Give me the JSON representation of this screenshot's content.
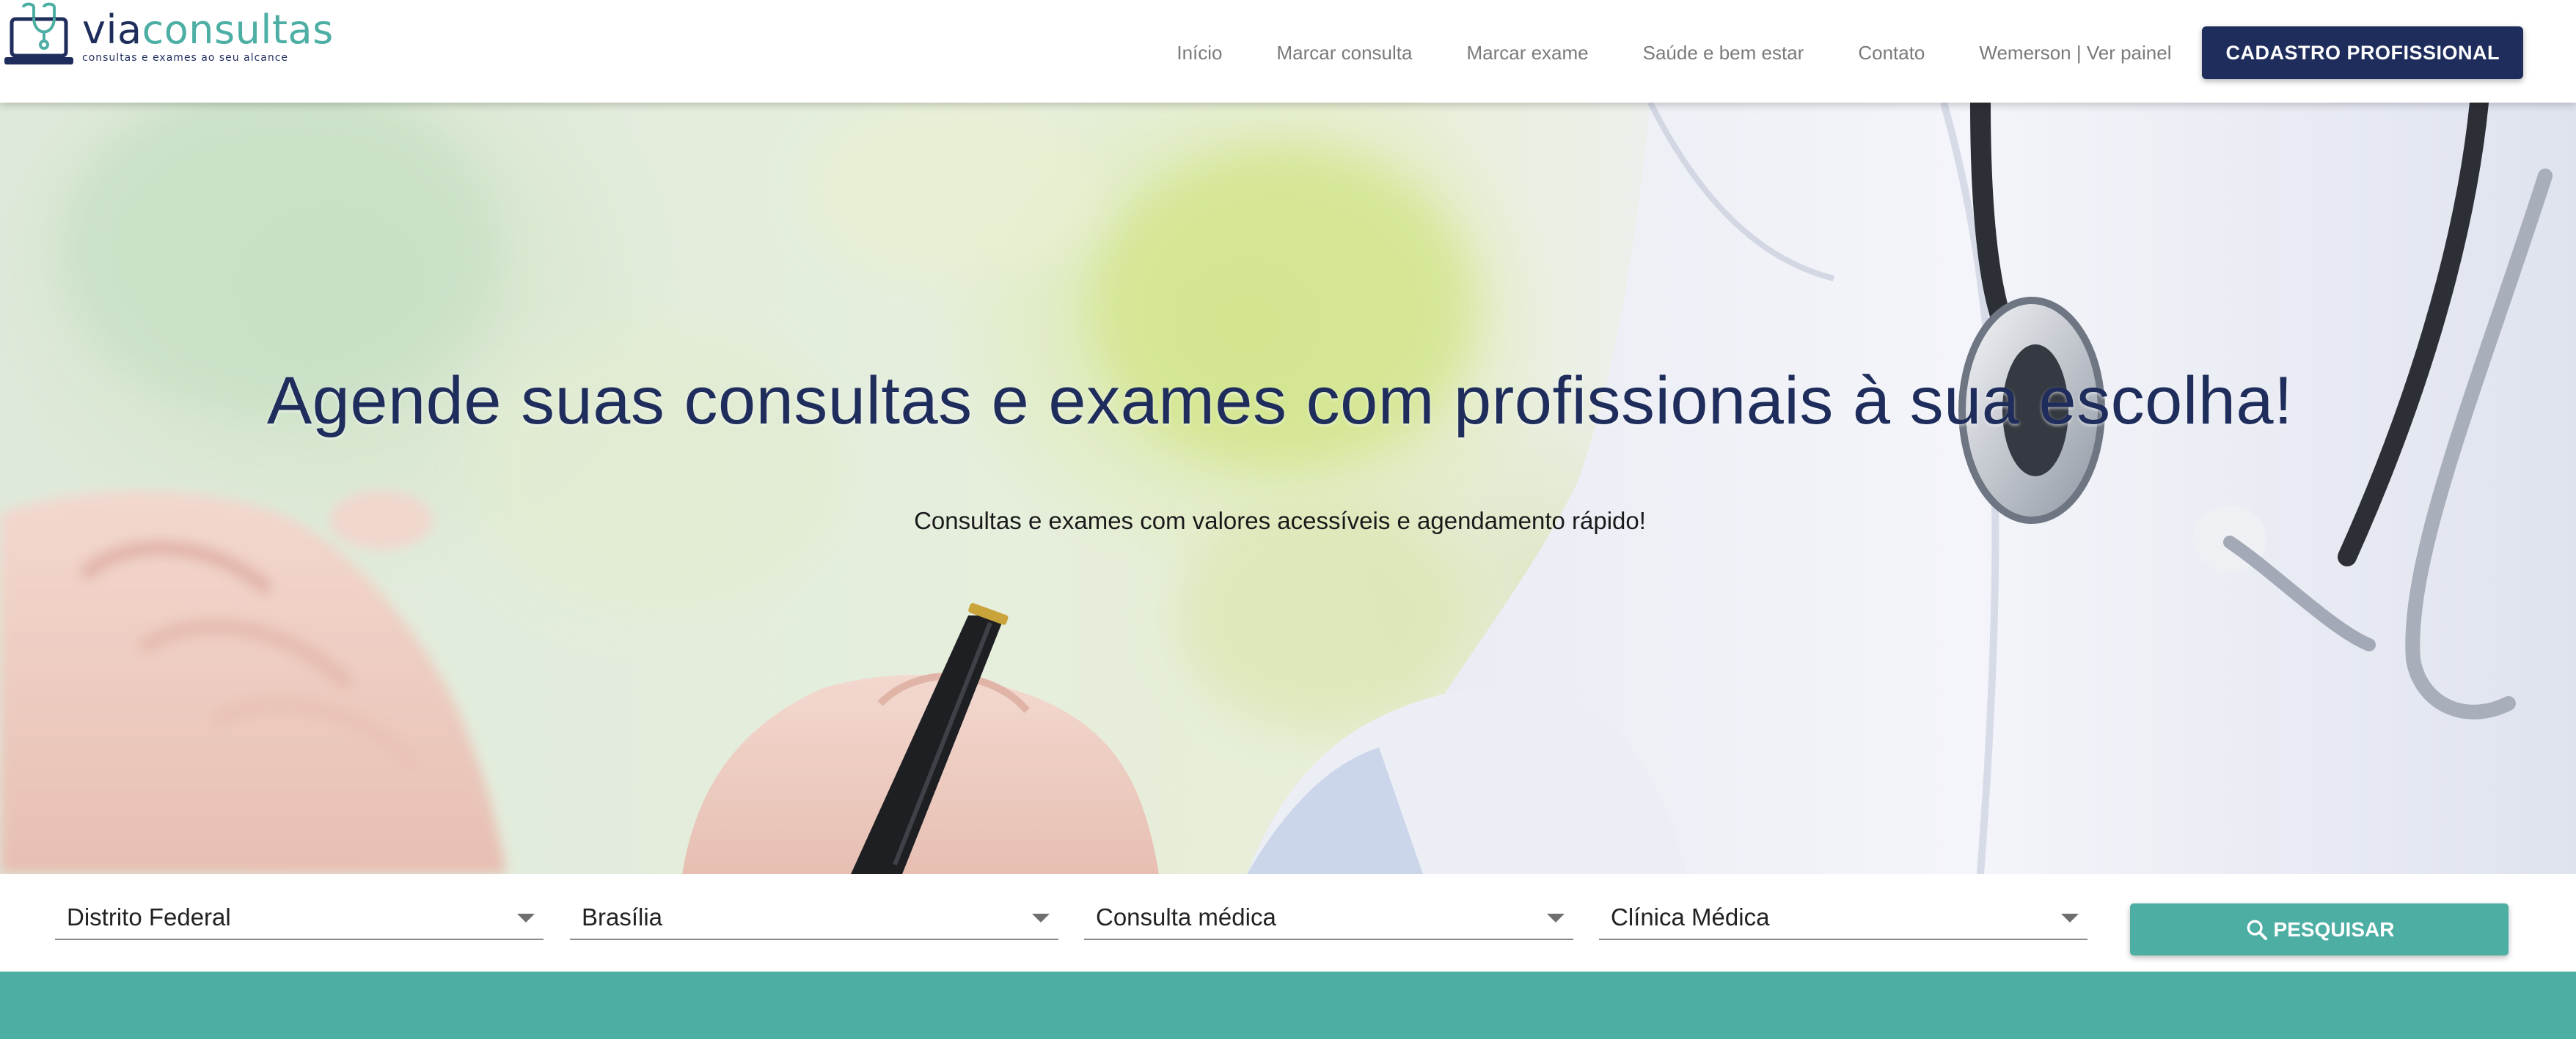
{
  "header": {
    "logo": {
      "word_via": "via",
      "word_consultas": "consultas",
      "tagline": "consultas e exames ao seu alcance",
      "icon": "laptop-stethoscope-icon"
    },
    "nav": [
      {
        "label": "Início"
      },
      {
        "label": "Marcar consulta"
      },
      {
        "label": "Marcar exame"
      },
      {
        "label": "Saúde e bem estar"
      },
      {
        "label": "Contato"
      },
      {
        "label": "Wemerson | Ver painel"
      }
    ],
    "cta_label": "CADASTRO PROFISSIONAL"
  },
  "hero": {
    "title": "Agende suas consultas e exames com profissionais à sua escolha!",
    "subtitle": "Consultas e exames com valores acessíveis e agendamento rápido!"
  },
  "search": {
    "state": "Distrito Federal",
    "city": "Brasília",
    "type": "Consulta médica",
    "specialty": "Clínica Médica",
    "button_label": "PESQUISAR",
    "button_icon": "search-icon"
  },
  "colors": {
    "brand_navy": "#1f2d5c",
    "brand_teal": "#4daea4",
    "nav_text": "#7a7a7a"
  }
}
